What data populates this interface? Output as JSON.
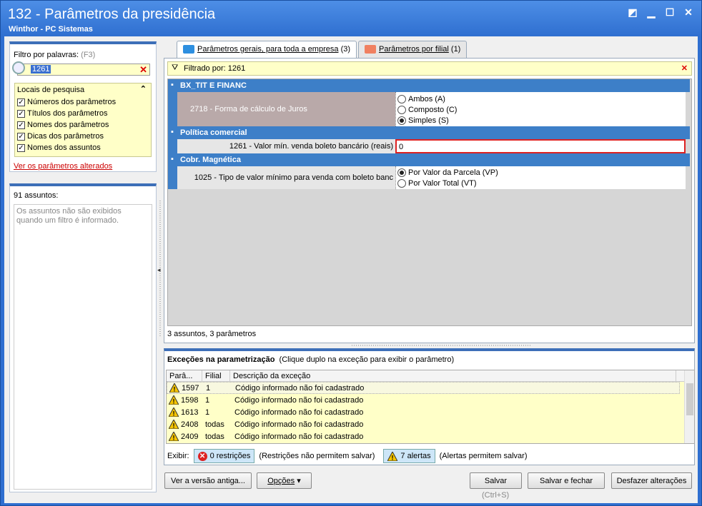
{
  "window": {
    "title": "132 - Parâmetros da presidência",
    "subtitle": "Winthor - PC Sistemas"
  },
  "left": {
    "filter_label": "Filtro por palavras:",
    "filter_shortcut": "(F3)",
    "search_value": "1261",
    "locais_title": "Locais de pesquisa",
    "locais": [
      "Números dos parâmetros",
      "Títulos dos parâmetros",
      "Nomes dos parâmetros",
      "Dicas dos parâmetros",
      "Nomes dos assuntos"
    ],
    "changed_link": "Ver os parâmetros alterados",
    "assuntos_count": "91 assuntos:",
    "assuntos_info": "Os assuntos não são exibidos quando um filtro é informado."
  },
  "tabs": [
    {
      "label": "Parâmetros gerais, para toda a empresa",
      "count": "(3)",
      "color": "#2d8fe0"
    },
    {
      "label": "Parâmetros por filial",
      "count": "(1)",
      "color": "#f08060"
    }
  ],
  "filtered_by": "Filtrado por: 1261",
  "sections": [
    {
      "title": "BX_TIT E FINANC"
    },
    {
      "title": "Política comercial"
    },
    {
      "title": "Cobr. Magnética"
    }
  ],
  "params": {
    "p2718": {
      "name": "2718 - Forma de cálculo de Juros",
      "options": [
        "Ambos (A)",
        "Composto (C)",
        "Simples (S)"
      ],
      "selected": 2
    },
    "p1261": {
      "name": "1261 - Valor mín. venda boleto bancário (reais)",
      "value": "0"
    },
    "p1025": {
      "name": "1025 - Tipo de valor mínimo para venda com boleto banc",
      "options": [
        "Por Valor da Parcela (VP)",
        "Por Valor Total (VT)"
      ],
      "selected": 0
    }
  },
  "status": "3 assuntos, 3 parâmetros",
  "exceptions": {
    "title": "Exceções na parametrização",
    "hint": "(Clique duplo na exceção para exibir o parâmetro)",
    "headers": [
      "Parâ...",
      "Filial",
      "Descrição da exceção"
    ],
    "rows": [
      {
        "param": "1597",
        "filial": "1",
        "desc": "Código informado não foi cadastrado"
      },
      {
        "param": "1598",
        "filial": "1",
        "desc": "Código informado não foi cadastrado"
      },
      {
        "param": "1613",
        "filial": "1",
        "desc": "Código informado não foi cadastrado"
      },
      {
        "param": "2408",
        "filial": "todas",
        "desc": "Código informado não foi cadastrado"
      },
      {
        "param": "2409",
        "filial": "todas",
        "desc": "Código informado não foi cadastrado"
      }
    ],
    "exibir_label": "Exibir:",
    "restricoes": "0 restrições",
    "restricoes_note": "(Restrições não permitem salvar)",
    "alertas": "7 alertas",
    "alertas_note": "(Alertas permitem salvar)"
  },
  "buttons": {
    "old_version": "Ver a versão antiga...",
    "options": "Opções",
    "save": "Salvar",
    "save_hint": "(Ctrl+S)",
    "save_close": "Salvar e fechar",
    "undo": "Desfazer alterações"
  }
}
